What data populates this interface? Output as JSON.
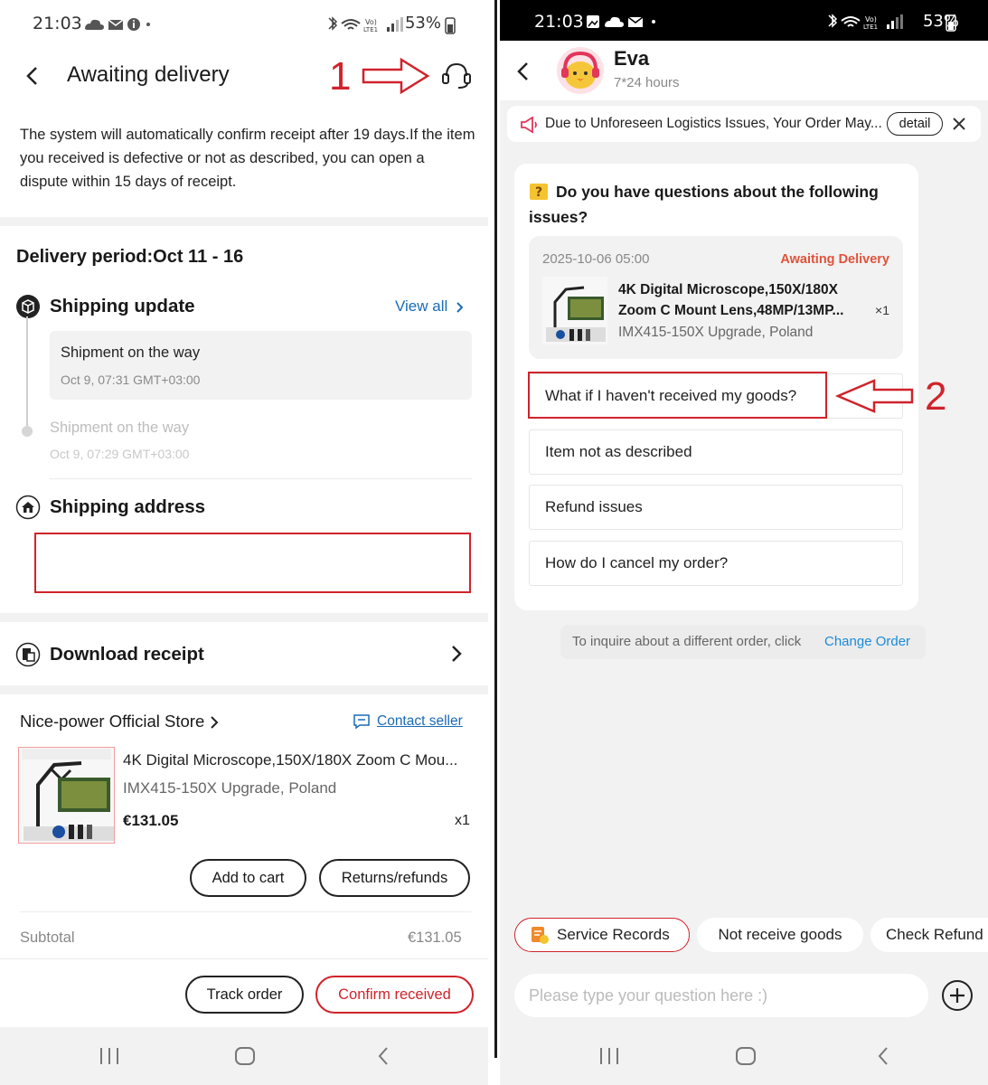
{
  "left": {
    "status_bar": {
      "time": "21:03",
      "battery": "53%"
    },
    "header": {
      "title": "Awaiting delivery",
      "annotation_number": "1"
    },
    "notice": "The system will automatically confirm receipt after 19 days.If the item you received is defective or not as described, you can open a dispute within 15 days of receipt.",
    "delivery_period": "Delivery period:Oct 11 - 16",
    "shipping_update": {
      "title": "Shipping update",
      "view_all": "View all",
      "events": [
        {
          "status": "Shipment on the way",
          "time": "Oct 9, 07:31 GMT+03:00"
        },
        {
          "status": "Shipment on the way",
          "time": "Oct 9, 07:29 GMT+03:00"
        }
      ]
    },
    "shipping_address": {
      "title": "Shipping address"
    },
    "download_receipt": "Download receipt",
    "store": {
      "name": "Nice-power Official Store",
      "contact_seller": "Contact seller",
      "product": {
        "title": "4K Digital Microscope,150X/180X Zoom C Mou...",
        "variant": "IMX415-150X Upgrade, Poland",
        "price": "€131.05",
        "qty": "x1"
      },
      "add_to_cart": "Add to cart",
      "returns": "Returns/refunds"
    },
    "subtotal": {
      "label": "Subtotal",
      "value": "€131.05"
    },
    "footer": {
      "track_order": "Track order",
      "confirm_received": "Confirm received"
    }
  },
  "right": {
    "status_bar": {
      "time": "21:03",
      "battery": "53%"
    },
    "agent": {
      "name": "Eva",
      "hours": "7*24 hours"
    },
    "notice": {
      "text": "Due to Unforeseen Logistics Issues, Your Order May...",
      "detail": "detail"
    },
    "question_card": {
      "title": "Do you have questions about the following issues?",
      "order": {
        "date": "2025-10-06 05:00",
        "status": "Awaiting Delivery",
        "title": "4K Digital Microscope,150X/180X Zoom C Mount Lens,48MP/13MP...",
        "variant": "IMX415-150X Upgrade, Poland",
        "qty": "×1"
      },
      "options": [
        "What if I haven't received my goods?",
        "Item not as described",
        "Refund issues",
        "How do I cancel my order?"
      ],
      "annotation_number": "2"
    },
    "change_order": {
      "text": "To inquire about a different order, click",
      "link": "Change Order"
    },
    "chips": [
      "Service Records",
      "Not receive goods",
      "Check Refund"
    ],
    "input": {
      "placeholder": "Please type your question here :)"
    }
  },
  "colors": {
    "accent_red": "#d0232b",
    "link_blue": "#1a6bb5",
    "status_orange": "#e0533a"
  }
}
